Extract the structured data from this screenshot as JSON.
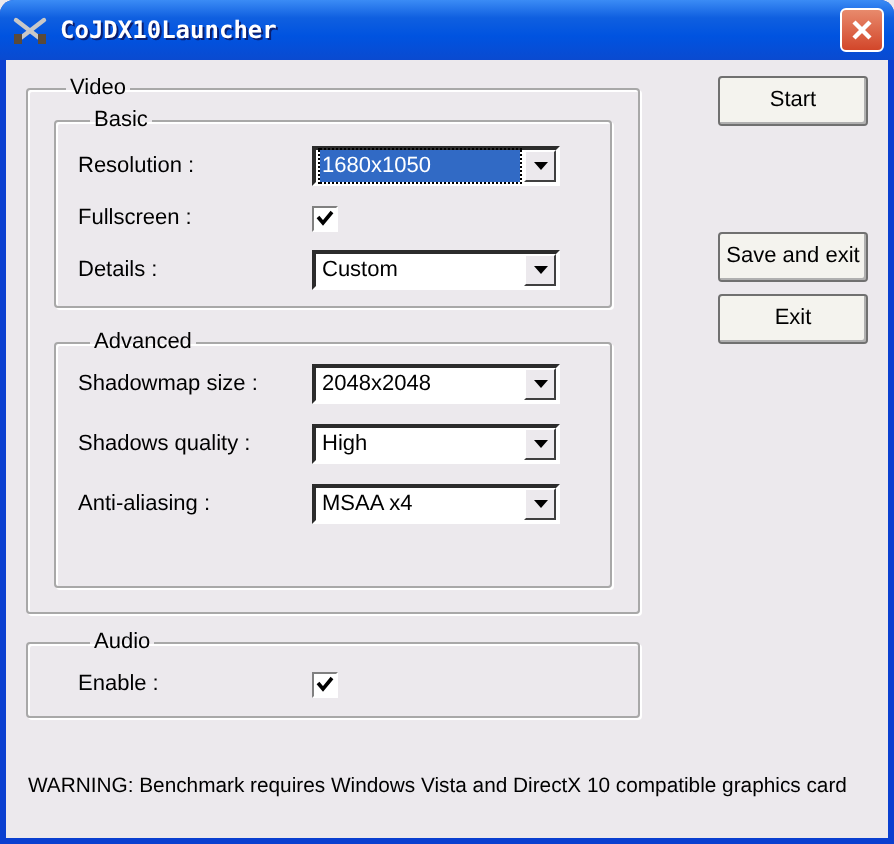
{
  "window": {
    "title": "CoJDX10Launcher"
  },
  "video": {
    "label": "Video",
    "groups": [
      {
        "label": "Basic",
        "rows": [
          {
            "kind": "combo",
            "label": "Resolution :",
            "value": "1680x1050",
            "focused": true
          },
          {
            "kind": "checkbox",
            "label": "Fullscreen :",
            "checked": true
          },
          {
            "kind": "combo",
            "label": "Details :",
            "value": "Custom",
            "focused": false
          }
        ]
      },
      {
        "label": "Advanced",
        "rows": [
          {
            "kind": "combo",
            "label": "Shadowmap size :",
            "value": "2048x2048",
            "focused": false
          },
          {
            "kind": "combo",
            "label": "Shadows quality :",
            "value": "High",
            "focused": false
          },
          {
            "kind": "combo",
            "label": "Anti-aliasing :",
            "value": "MSAA x4",
            "focused": false
          }
        ]
      }
    ]
  },
  "audio": {
    "label": "Audio",
    "rows": [
      {
        "kind": "checkbox",
        "label": "Enable :",
        "checked": true
      }
    ]
  },
  "buttons": [
    {
      "label": "Start"
    },
    {
      "label": "Save and exit"
    },
    {
      "label": "Exit"
    }
  ],
  "warning": "WARNING: Benchmark requires Windows Vista and DirectX 10 compatible graphics card"
}
